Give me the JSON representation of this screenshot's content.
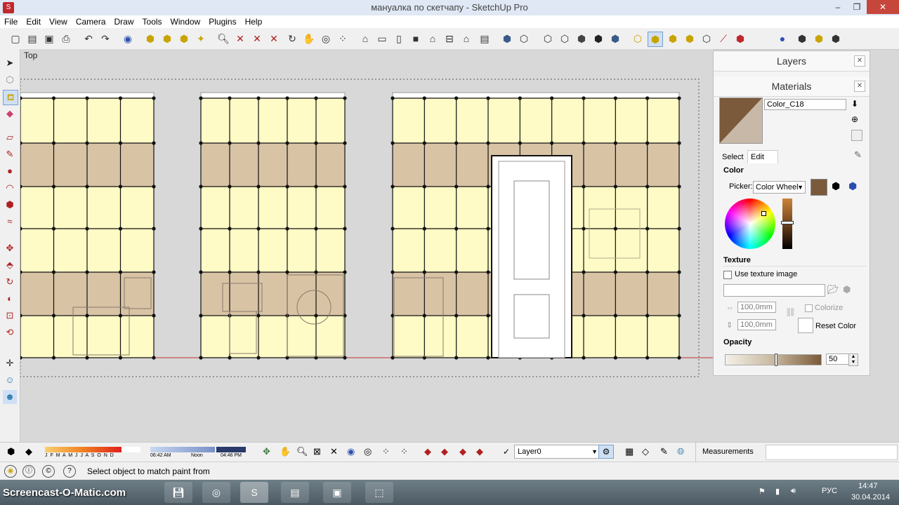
{
  "window": {
    "title": "мануалка по скетчапу - SketchUp Pro",
    "app_icon": "sketchup-icon",
    "minimize": "‒",
    "maximize": "❐",
    "close": "✕"
  },
  "menu": [
    "File",
    "Edit",
    "View",
    "Camera",
    "Draw",
    "Tools",
    "Window",
    "Plugins",
    "Help"
  ],
  "scene": {
    "label": "Top"
  },
  "layers_panel": {
    "title": "Layers",
    "close": "✕"
  },
  "materials_panel": {
    "title": "Materials",
    "close": "✕",
    "material_name": "Color_C18",
    "swatch_color": "#7a5a3a",
    "tabs": {
      "select": "Select",
      "edit": "Edit"
    },
    "color_section": "Color",
    "picker_label": "Picker:",
    "picker_value": "Color Wheel",
    "texture_section": "Texture",
    "use_texture_label": "Use texture image",
    "width_value": "100,0mm",
    "height_value": "100,0mm",
    "colorize_label": "Colorize",
    "reset_label": "Reset Color",
    "opacity_section": "Opacity",
    "opacity_value": "50"
  },
  "shadow_bar": {
    "months": "J F M A M J J A S O N D",
    "time_start": "06:42 AM",
    "time_mid": "Noon",
    "time_end": "04:46 PM"
  },
  "layer_select": {
    "check": "✓",
    "value": "Layer0"
  },
  "measurements_label": "Measurements",
  "status_text": "Select object to match paint from",
  "taskbar": {
    "watermark": "Screencast-O-Matic.com",
    "lang": "РУС",
    "time": "14:47",
    "date": "30.04.2014"
  },
  "colors": {
    "wall_light": "#fefbc6",
    "wall_band": "#d8c3a5",
    "grid": "#111111"
  }
}
